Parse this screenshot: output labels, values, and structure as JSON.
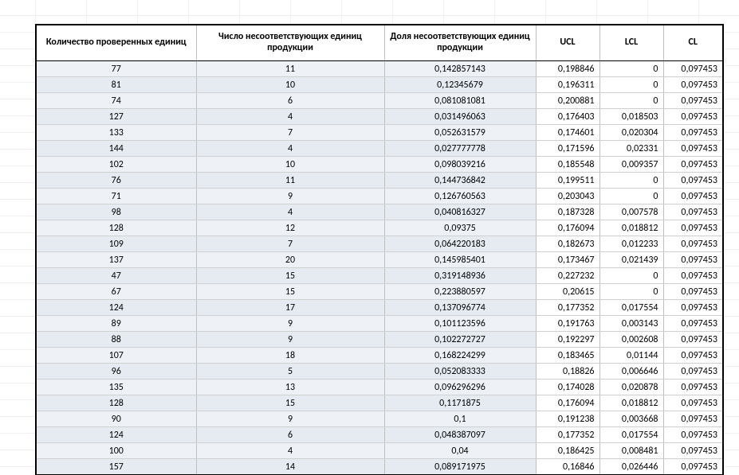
{
  "headers": {
    "col1": "Количество проверенных единиц",
    "col2": "Число несоответствующих единиц продукции",
    "col3": "Доля несоответствующих единиц продукции",
    "col4": "UCL",
    "col5": "LCL",
    "col6": "CL"
  },
  "rows": [
    {
      "n": "77",
      "d": "11",
      "p": "0,142857143",
      "ucl": "0,198846",
      "lcl": "0",
      "cl": "0,097453"
    },
    {
      "n": "81",
      "d": "10",
      "p": "0,12345679",
      "ucl": "0,196311",
      "lcl": "0",
      "cl": "0,097453"
    },
    {
      "n": "74",
      "d": "6",
      "p": "0,081081081",
      "ucl": "0,200881",
      "lcl": "0",
      "cl": "0,097453"
    },
    {
      "n": "127",
      "d": "4",
      "p": "0,031496063",
      "ucl": "0,176403",
      "lcl": "0,018503",
      "cl": "0,097453"
    },
    {
      "n": "133",
      "d": "7",
      "p": "0,052631579",
      "ucl": "0,174601",
      "lcl": "0,020304",
      "cl": "0,097453"
    },
    {
      "n": "144",
      "d": "4",
      "p": "0,027777778",
      "ucl": "0,171596",
      "lcl": "0,02331",
      "cl": "0,097453"
    },
    {
      "n": "102",
      "d": "10",
      "p": "0,098039216",
      "ucl": "0,185548",
      "lcl": "0,009357",
      "cl": "0,097453"
    },
    {
      "n": "76",
      "d": "11",
      "p": "0,144736842",
      "ucl": "0,199511",
      "lcl": "0",
      "cl": "0,097453"
    },
    {
      "n": "71",
      "d": "9",
      "p": "0,126760563",
      "ucl": "0,203043",
      "lcl": "0",
      "cl": "0,097453"
    },
    {
      "n": "98",
      "d": "4",
      "p": "0,040816327",
      "ucl": "0,187328",
      "lcl": "0,007578",
      "cl": "0,097453"
    },
    {
      "n": "128",
      "d": "12",
      "p": "0,09375",
      "ucl": "0,176094",
      "lcl": "0,018812",
      "cl": "0,097453"
    },
    {
      "n": "109",
      "d": "7",
      "p": "0,064220183",
      "ucl": "0,182673",
      "lcl": "0,012233",
      "cl": "0,097453"
    },
    {
      "n": "137",
      "d": "20",
      "p": "0,145985401",
      "ucl": "0,173467",
      "lcl": "0,021439",
      "cl": "0,097453"
    },
    {
      "n": "47",
      "d": "15",
      "p": "0,319148936",
      "ucl": "0,227232",
      "lcl": "0",
      "cl": "0,097453"
    },
    {
      "n": "67",
      "d": "15",
      "p": "0,223880597",
      "ucl": "0,20615",
      "lcl": "0",
      "cl": "0,097453"
    },
    {
      "n": "124",
      "d": "17",
      "p": "0,137096774",
      "ucl": "0,177352",
      "lcl": "0,017554",
      "cl": "0,097453"
    },
    {
      "n": "89",
      "d": "9",
      "p": "0,101123596",
      "ucl": "0,191763",
      "lcl": "0,003143",
      "cl": "0,097453"
    },
    {
      "n": "88",
      "d": "9",
      "p": "0,102272727",
      "ucl": "0,192297",
      "lcl": "0,002608",
      "cl": "0,097453"
    },
    {
      "n": "107",
      "d": "18",
      "p": "0,168224299",
      "ucl": "0,183465",
      "lcl": "0,01144",
      "cl": "0,097453"
    },
    {
      "n": "96",
      "d": "5",
      "p": "0,052083333",
      "ucl": "0,18826",
      "lcl": "0,006646",
      "cl": "0,097453"
    },
    {
      "n": "135",
      "d": "13",
      "p": "0,096296296",
      "ucl": "0,174028",
      "lcl": "0,020878",
      "cl": "0,097453"
    },
    {
      "n": "128",
      "d": "15",
      "p": "0,1171875",
      "ucl": "0,176094",
      "lcl": "0,018812",
      "cl": "0,097453"
    },
    {
      "n": "90",
      "d": "9",
      "p": "0,1",
      "ucl": "0,191238",
      "lcl": "0,003668",
      "cl": "0,097453"
    },
    {
      "n": "124",
      "d": "6",
      "p": "0,048387097",
      "ucl": "0,177352",
      "lcl": "0,017554",
      "cl": "0,097453"
    },
    {
      "n": "100",
      "d": "4",
      "p": "0,04",
      "ucl": "0,186425",
      "lcl": "0,008481",
      "cl": "0,097453"
    },
    {
      "n": "157",
      "d": "14",
      "p": "0,089171975",
      "ucl": "0,16846",
      "lcl": "0,026446",
      "cl": "0,097453"
    }
  ]
}
